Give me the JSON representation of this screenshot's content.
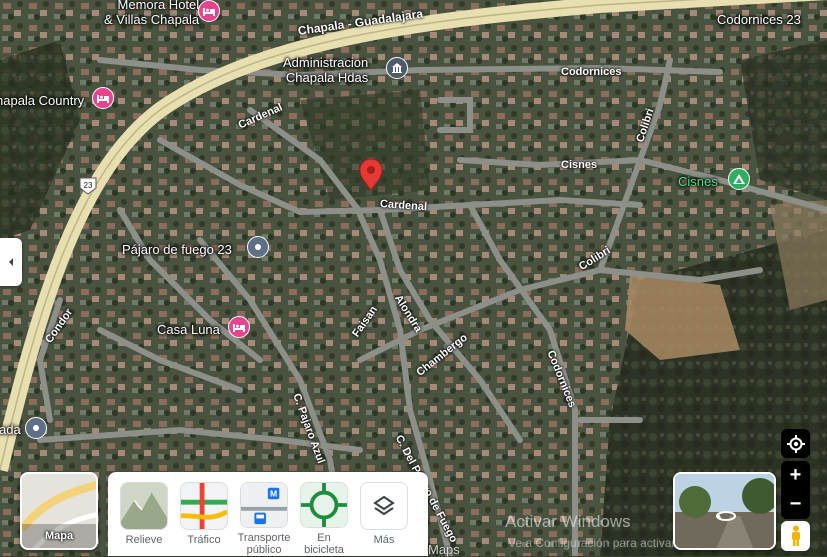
{
  "map": {
    "highways": [
      {
        "name": "Chapala - Guadalajara"
      }
    ],
    "route_shield": "23",
    "streets": [
      "Codornices",
      "Cardenal",
      "Cardenal",
      "Cisnes",
      "Colibri",
      "Colibri",
      "Alondra",
      "Faisan",
      "Chambergo",
      "Codornices",
      "C. Pajaro Azul",
      "C. Del Pajaro de Fuego",
      "Condor"
    ]
  },
  "places": [
    {
      "name_line1": "Memora Hotel",
      "name_line2": "& Villas Chapala",
      "icon": "hotel-icon",
      "color": "#e8438f"
    },
    {
      "name": "Administracion",
      "name_line2": "Chapala Hdas",
      "icon": "building-icon",
      "color": "#4d5b6b"
    },
    {
      "name": "Codornices 23",
      "icon": "pin-icon"
    },
    {
      "name": "hapala Country",
      "icon": "hotel-icon",
      "color": "#e8438f"
    },
    {
      "name": "Cisnes",
      "icon": "park-icon",
      "color": "#2fae62"
    },
    {
      "name": "Pájaro de fuego 23",
      "icon": "pin-icon",
      "color": "#5e7087"
    },
    {
      "name": "Casa Luna",
      "icon": "hotel-icon",
      "color": "#e8438f"
    },
    {
      "name": "ada",
      "icon": "pin-icon",
      "color": "#5e7087"
    }
  ],
  "selected_pin": {
    "color": "#e53935"
  },
  "layers": {
    "main_label": "Mapa",
    "options": [
      {
        "label": "Relieve"
      },
      {
        "label": "Tráfico"
      },
      {
        "label": "Transporte público"
      },
      {
        "label": "En bicicleta"
      },
      {
        "label": "Más"
      }
    ]
  },
  "controls": {
    "zoom_in": "+",
    "zoom_out": "−"
  },
  "footer": {
    "maps_word": "Maps",
    "watermark": "Activar Windows",
    "watermark_sub": "Ve a Configuración para activar Windows"
  }
}
